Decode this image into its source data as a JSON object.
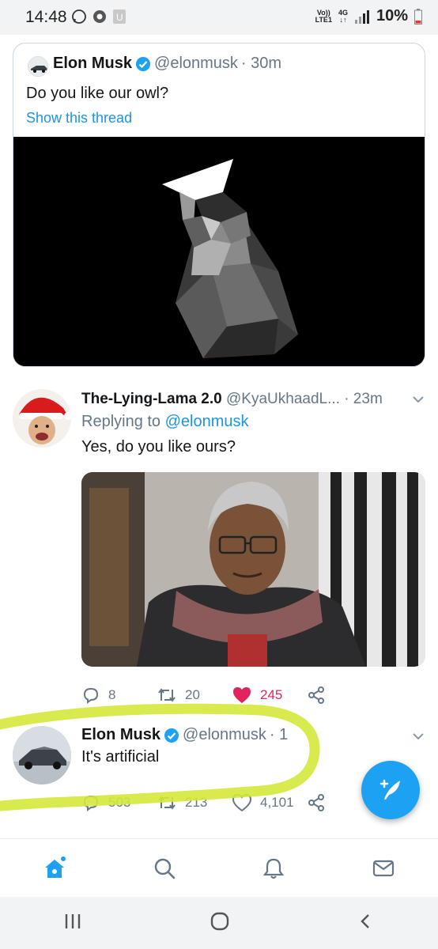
{
  "status_bar": {
    "time": "14:48",
    "network_top": "Vo))",
    "network_bottom": "LTE1",
    "network_gen": "4G",
    "battery": "10%"
  },
  "quoted_tweet": {
    "name": "Elon Musk",
    "handle": "@elonmusk",
    "time": "· 30m",
    "text": "Do you like our owl?",
    "show_thread": "Show this thread"
  },
  "reply_tweet": {
    "name": "The-Lying-Lama 2.0",
    "handle": "@KyaUkhaadL...",
    "time": "· 23m",
    "replying_prefix": "Replying to",
    "replying_to": "@elonmusk",
    "text": "Yes, do you like ours?",
    "replies": "8",
    "retweets": "20",
    "likes": "245"
  },
  "third_tweet": {
    "name": "Elon Musk",
    "handle": "@elonmusk",
    "time": "· 1",
    "text": "It's artificial",
    "replies": "503",
    "retweets": "213",
    "likes": "4,101"
  },
  "colors": {
    "accent": "#1da1f2",
    "link": "#1b95e0",
    "like": "#e0245e",
    "highlighter": "#d4e83a"
  },
  "icons": {
    "compose": "compose-tweet-icon",
    "home": "home-icon",
    "search": "search-icon",
    "notifications": "bell-icon",
    "messages": "mail-icon"
  }
}
